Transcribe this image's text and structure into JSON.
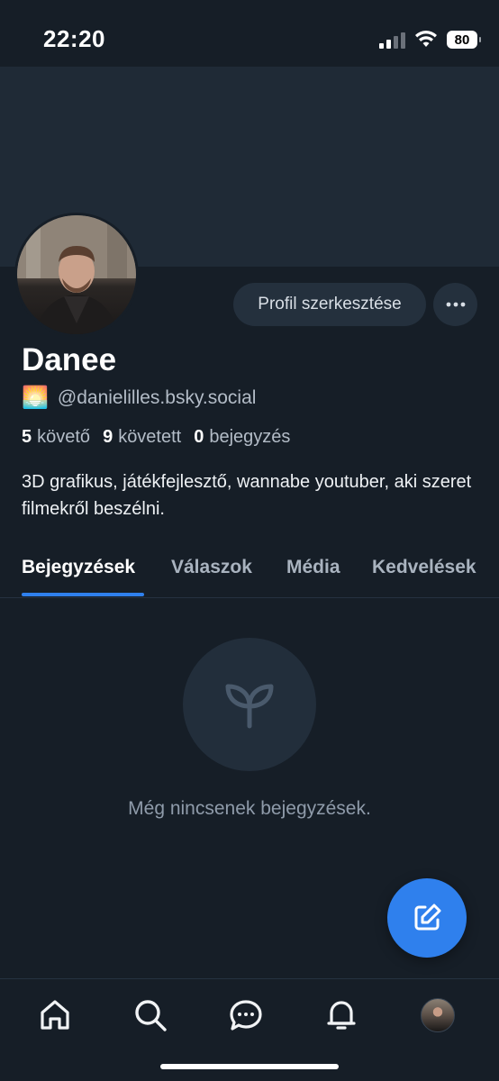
{
  "status_bar": {
    "time": "22:20",
    "battery": "80"
  },
  "profile": {
    "display_name": "Danee",
    "handle": "@danielilles.bsky.social",
    "emoji": "🌅",
    "edit_label": "Profil szerkesztése",
    "stats": {
      "followers_count": "5",
      "followers_label": "követő",
      "following_count": "9",
      "following_label": "követett",
      "posts_count": "0",
      "posts_label": "bejegyzés"
    },
    "bio": "3D grafikus, játékfejlesztő, wannabe youtuber, aki szeret filmekről beszélni."
  },
  "tabs": [
    {
      "label": "Bejegyzések",
      "active": true
    },
    {
      "label": "Válaszok",
      "active": false
    },
    {
      "label": "Média",
      "active": false
    },
    {
      "label": "Kedvelések",
      "active": false
    }
  ],
  "empty_state": {
    "icon": "sprout-icon",
    "text": "Még nincsenek bejegyzések."
  },
  "bottom_nav": [
    {
      "name": "home-icon"
    },
    {
      "name": "search-icon"
    },
    {
      "name": "chat-icon"
    },
    {
      "name": "bell-icon"
    },
    {
      "name": "profile-avatar"
    }
  ],
  "colors": {
    "accent": "#2f80ed",
    "background": "#161e27",
    "banner": "#1f2a36"
  }
}
